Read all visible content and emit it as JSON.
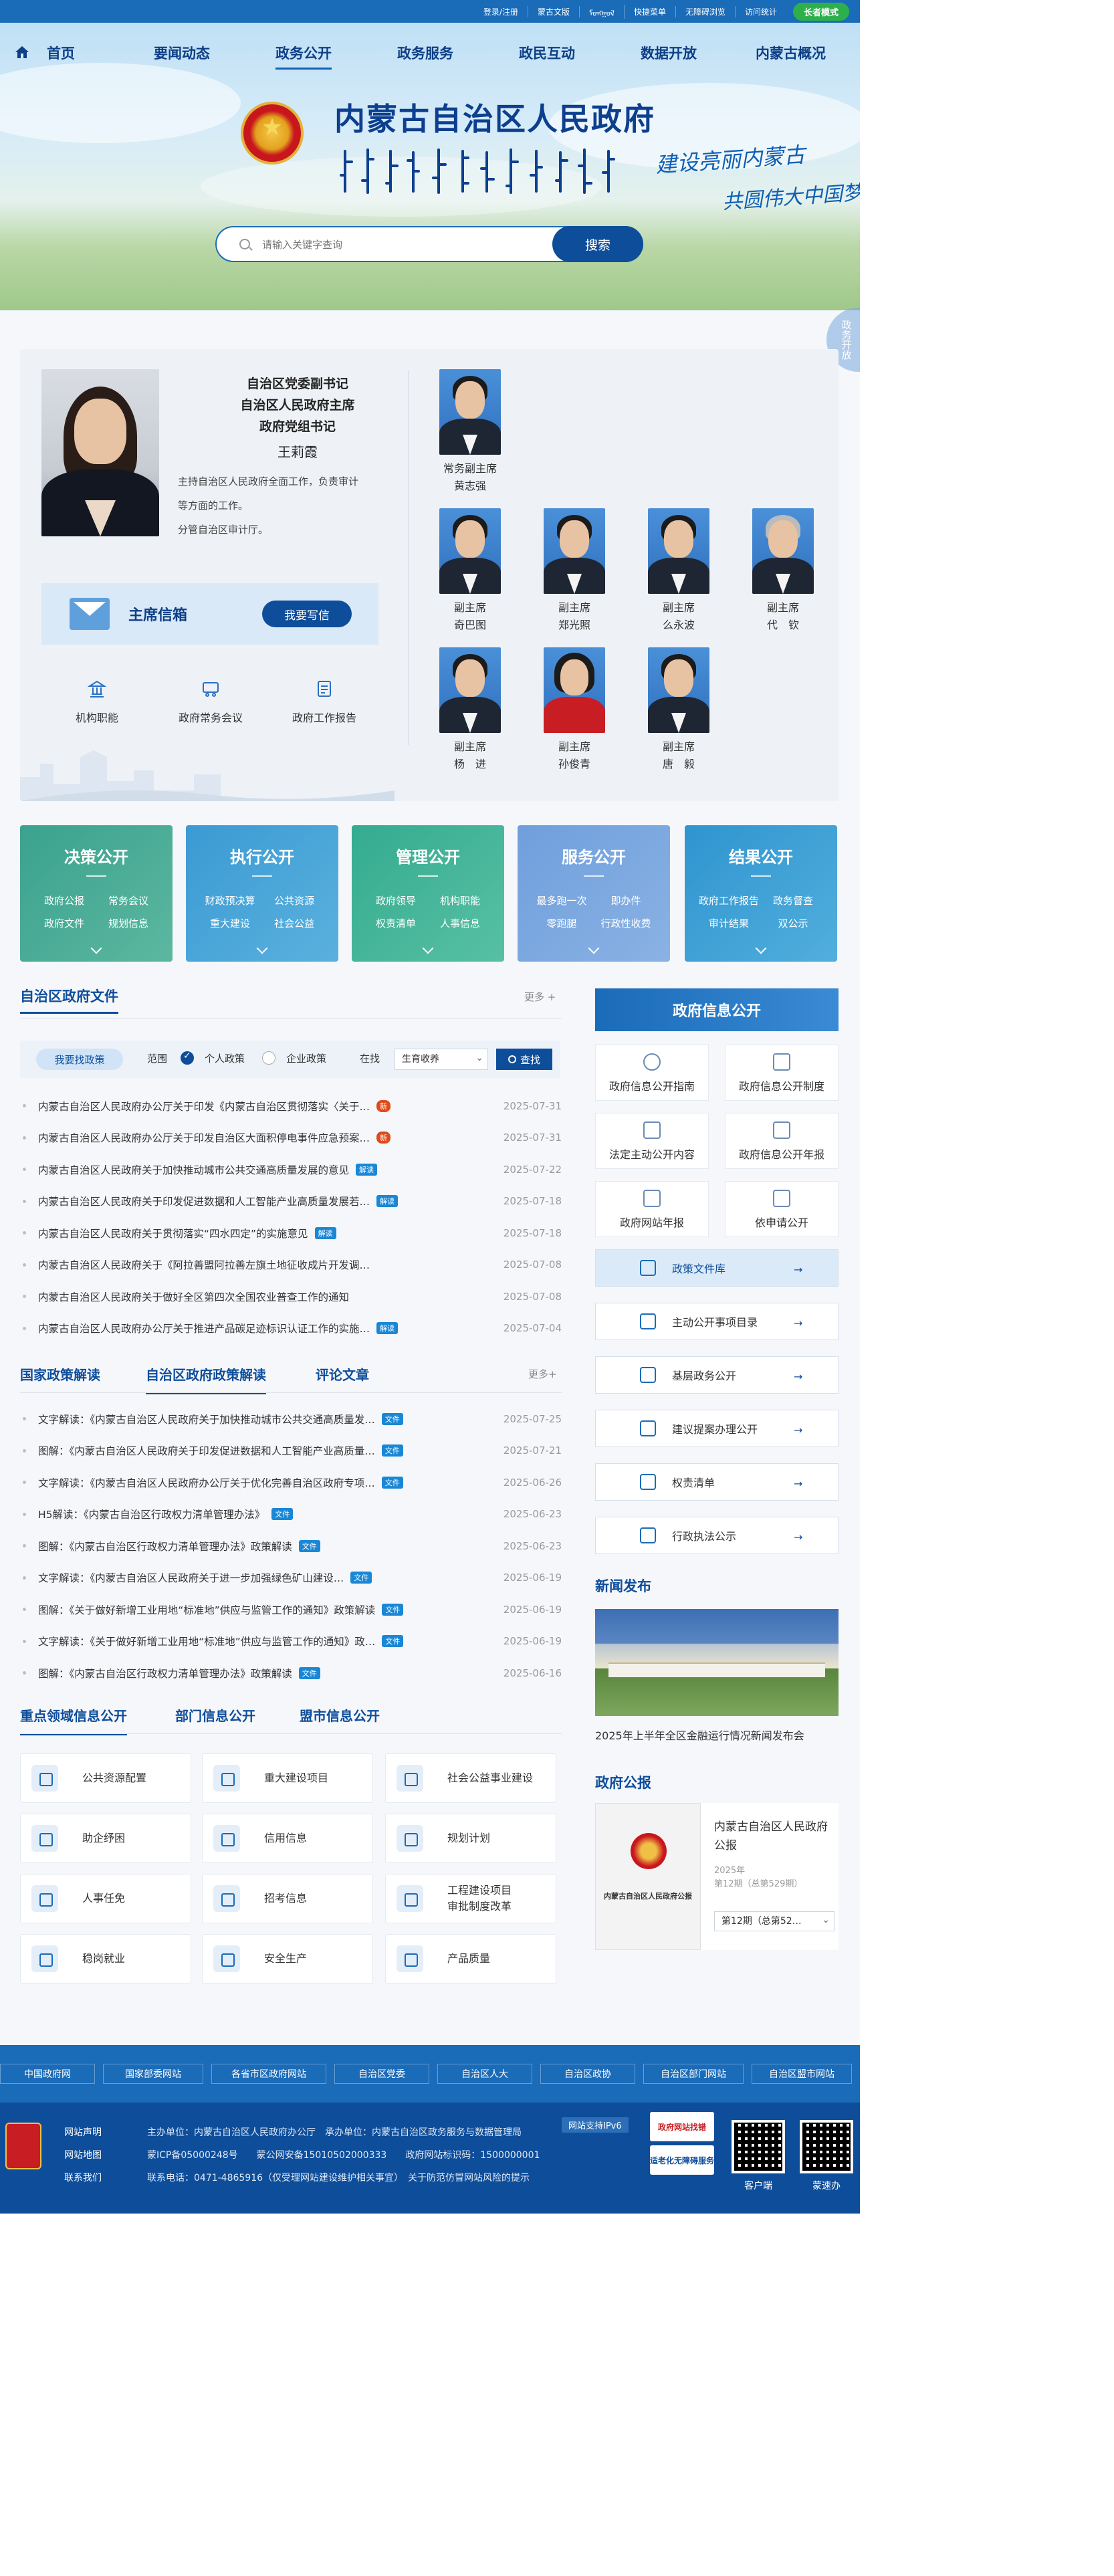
{
  "topbar": {
    "links": [
      "登录/注册",
      "蒙古文版",
      "ᠮᠣᠩᠭᠣᠯ",
      "快捷菜单",
      "无障碍浏览",
      "访问统计"
    ],
    "elder_mode": "长者模式"
  },
  "nav": {
    "items": [
      "首页",
      "要闻动态",
      "政务公开",
      "政务服务",
      "政民互动",
      "数据开放",
      "内蒙古概况"
    ],
    "active": "政务公开"
  },
  "header": {
    "site_title": "内蒙古自治区人民政府",
    "slogan_line1": "建设亮丽内蒙古",
    "slogan_line2": "共圆伟大中国梦",
    "side_float": "政务开放"
  },
  "search": {
    "placeholder": "请输入关键字查询",
    "button": "搜索"
  },
  "chairman": {
    "titles": [
      "自治区党委副书记",
      "自治区人民政府主席",
      "政府党组书记"
    ],
    "name": "王莉霞",
    "duties": [
      "主持自治区人民政府全面工作，负责审计",
      "等方面的工作。",
      "分管自治区审计厅。"
    ],
    "mailbox_label": "主席信箱",
    "mailbox_button": "我要写信"
  },
  "leader_links": [
    "机构职能",
    "政府常务会议",
    "政府工作报告"
  ],
  "vice_leaders": [
    {
      "title": "常务副主席",
      "name": "黄志强"
    },
    {
      "title": "副主席",
      "name": "奇巴图"
    },
    {
      "title": "副主席",
      "name": "郑光照"
    },
    {
      "title": "副主席",
      "name": "么永波"
    },
    {
      "title": "副主席",
      "name": "代　钦"
    },
    {
      "title": "副主席",
      "name": "杨　进"
    },
    {
      "title": "副主席",
      "name": "孙俊青"
    },
    {
      "title": "副主席",
      "name": "唐　毅"
    }
  ],
  "categories": [
    {
      "title": "决策公开",
      "links": [
        "政府公报",
        "常务会议",
        "政府文件",
        "规划信息"
      ],
      "color1": "#3aa28e",
      "color2": "#5cb7a0"
    },
    {
      "title": "执行公开",
      "links": [
        "财政预决算",
        "公共资源",
        "重大建设",
        "社会公益"
      ],
      "color1": "#3b9ad3",
      "color2": "#5ab1de"
    },
    {
      "title": "管理公开",
      "links": [
        "政府领导",
        "机构职能",
        "权责清单",
        "人事信息"
      ],
      "color1": "#34ab8f",
      "color2": "#58c0a4"
    },
    {
      "title": "服务公开",
      "links": [
        "最多跑一次",
        "即办件",
        "零跑腿",
        "行政性收费"
      ],
      "color1": "#6f9fdc",
      "color2": "#8ab2e4"
    },
    {
      "title": "结果公开",
      "links": [
        "政府工作报告",
        "政务督查",
        "审计结果",
        "双公示"
      ],
      "color1": "#2f95cf",
      "color2": "#52aedd"
    }
  ],
  "policy_files": {
    "heading": "自治区政府文件",
    "more": "更多 +",
    "filter": {
      "chip": "我要找政策",
      "range_label": "范围",
      "option1": "个人政策",
      "option2": "企业政策",
      "stage_label": "在找",
      "stage_value": "生育收养",
      "find": "查找"
    },
    "items": [
      {
        "title": "内蒙古自治区人民政府办公厅关于印发《内蒙古自治区贯彻落实〈关于…",
        "badge": "新",
        "date": "2025-07-31"
      },
      {
        "title": "内蒙古自治区人民政府办公厅关于印发自治区大面积停电事件应急预案…",
        "badge": "新",
        "date": "2025-07-31"
      },
      {
        "title": "内蒙古自治区人民政府关于加快推动城市公共交通高质量发展的意见",
        "badge": "解读",
        "date": "2025-07-22"
      },
      {
        "title": "内蒙古自治区人民政府关于印发促进数据和人工智能产业高质量发展若…",
        "badge": "解读",
        "date": "2025-07-18"
      },
      {
        "title": "内蒙古自治区人民政府关于贯彻落实“四水四定”的实施意见",
        "badge": "解读",
        "date": "2025-07-18"
      },
      {
        "title": "内蒙古自治区人民政府关于《阿拉善盟阿拉善左旗土地征收成片开发调…",
        "badge": "",
        "date": "2025-07-08"
      },
      {
        "title": "内蒙古自治区人民政府关于做好全区第四次全国农业普查工作的通知",
        "badge": "",
        "date": "2025-07-08"
      },
      {
        "title": "内蒙古自治区人民政府办公厅关于推进产品碳足迹标识认证工作的实施…",
        "badge": "解读",
        "date": "2025-07-04"
      }
    ]
  },
  "interpret": {
    "tabs": [
      "国家政策解读",
      "自治区政府政策解读",
      "评论文章"
    ],
    "active": "自治区政府政策解读",
    "more": "更多+",
    "items": [
      {
        "title": "文字解读：《内蒙古自治区人民政府关于加快推动城市公共交通高质量发…",
        "badge": "文件",
        "date": "2025-07-25"
      },
      {
        "title": "图解：《内蒙古自治区人民政府关于印发促进数据和人工智能产业高质量…",
        "badge": "文件",
        "date": "2025-07-21"
      },
      {
        "title": "文字解读：《内蒙古自治区人民政府办公厅关于优化完善自治区政府专项…",
        "badge": "文件",
        "date": "2025-06-26"
      },
      {
        "title": "H5解读：《内蒙古自治区行政权力清单管理办法》",
        "badge": "文件",
        "date": "2025-06-23"
      },
      {
        "title": "图解：《内蒙古自治区行政权力清单管理办法》政策解读",
        "badge": "文件",
        "date": "2025-06-23"
      },
      {
        "title": "文字解读：《内蒙古自治区人民政府关于进一步加强绿色矿山建设…",
        "badge": "文件",
        "date": "2025-06-19"
      },
      {
        "title": "图解：《关于做好新增工业用地“标准地”供应与监管工作的通知》政策解读",
        "badge": "文件",
        "date": "2025-06-19"
      },
      {
        "title": "文字解读：《关于做好新增工业用地“标准地”供应与监管工作的通知》政…",
        "badge": "文件",
        "date": "2025-06-19"
      },
      {
        "title": "图解：《内蒙古自治区行政权力清单管理办法》政策解读",
        "badge": "文件",
        "date": "2025-06-16"
      }
    ]
  },
  "key_areas": {
    "tabs": [
      "重点领域信息公开",
      "部门信息公开",
      "盟市信息公开"
    ],
    "active": "重点领域信息公开",
    "items": [
      "公共资源配置",
      "重大建设项目",
      "社会公益事业建设",
      "助企纾困",
      "信用信息",
      "规划计划",
      "人事任免",
      "招考信息",
      "工程建设项目\n审批制度改革",
      "稳岗就业",
      "安全生产",
      "产品质量"
    ]
  },
  "gov_info": {
    "heading": "政府信息公开",
    "grid": [
      "政府信息公开指南",
      "政府信息公开制度",
      "法定主动公开内容",
      "政府信息公开年报",
      "政府网站年报",
      "依申请公开"
    ],
    "links": [
      "政策文件库",
      "主动公开事项目录",
      "基层政务公开",
      "建议提案办理公开",
      "权责清单",
      "行政执法公示"
    ],
    "highlight": "政策文件库"
  },
  "news": {
    "heading": "新闻发布",
    "caption": "2025年上半年全区金融运行情况新闻发布会"
  },
  "gazette": {
    "heading": "政府公报",
    "cover_title": "内蒙古自治区人民政府公报",
    "title": "内蒙古自治区人民政府公报",
    "year": "2025年",
    "issue": "第12期（总第529期）",
    "select": "第12期（总第52…"
  },
  "footer": {
    "links": [
      "中国政府网",
      "国家部委网站",
      "各省市区政府网站",
      "自治区党委",
      "自治区人大",
      "自治区政协",
      "自治区部门网站",
      "自治区盟市网站"
    ],
    "side_links": [
      "网站声明",
      "网站地图",
      "联系我们"
    ],
    "info_line1": "主办单位：内蒙古自治区人民政府办公厅　承办单位：内蒙古自治区政务服务与数据管理局",
    "ipv6": "网站支持IPv6",
    "info_line2": "蒙ICP备05000248号",
    "info_line2b": "蒙公网安备15010502000333　　政府网站标识码：1500000001",
    "info_line3": "联系电话：0471-4865916（仅受理网站建设维护相关事宜）　关于防范仿冒网站风险的提示",
    "badge1": "政府网站找错",
    "badge2": "适老化无障碍服务",
    "qr1": "客户端",
    "qr2": "蒙速办"
  }
}
